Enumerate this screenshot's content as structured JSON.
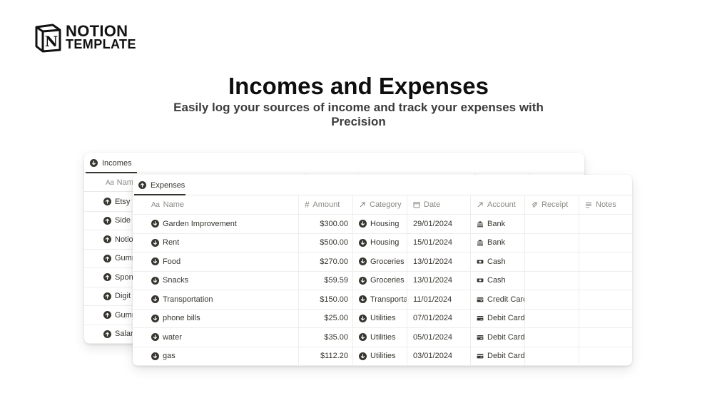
{
  "logo": {
    "line1": "NOTION",
    "line2": "TEMPLATE",
    "mark": "N"
  },
  "hero": {
    "title": "Incomes and Expenses",
    "subtitle": "Easily log your sources of income and track your expenses with Precision"
  },
  "incomes": {
    "tab_label": "Incomes",
    "tab_icon": "arrow-down-circle-icon",
    "name_header": "Nam",
    "rows": [
      {
        "name": "Etsy S"
      },
      {
        "name": "Side I"
      },
      {
        "name": "Notio"
      },
      {
        "name": "Gumr"
      },
      {
        "name": "Spon"
      },
      {
        "name": "Digit"
      },
      {
        "name": "Gumr"
      },
      {
        "name": "Salar"
      }
    ]
  },
  "expenses": {
    "tab_label": "Expenses",
    "tab_icon": "arrow-up-circle-icon",
    "columns": {
      "name": "Name",
      "amount": "Amount",
      "category": "Category",
      "date": "Date",
      "account": "Account",
      "receipt": "Receipt",
      "notes": "Notes"
    },
    "rows": [
      {
        "name": "Garden Improvement",
        "amount": "$300.00",
        "category": "Housing",
        "date": "29/01/2024",
        "account": "Bank",
        "account_icon": "bank-icon"
      },
      {
        "name": "Rent",
        "amount": "$500.00",
        "category": "Housing",
        "date": "15/01/2024",
        "account": "Bank",
        "account_icon": "bank-icon"
      },
      {
        "name": "Food",
        "amount": "$270.00",
        "category": "Groceries",
        "date": "13/01/2024",
        "account": "Cash",
        "account_icon": "cash-icon"
      },
      {
        "name": "Snacks",
        "amount": "$59.59",
        "category": "Groceries",
        "date": "13/01/2024",
        "account": "Cash",
        "account_icon": "cash-icon"
      },
      {
        "name": "Transportation",
        "amount": "$150.00",
        "category": "Transporta",
        "date": "11/01/2024",
        "account": "Credit Carc",
        "account_icon": "credit-card-icon"
      },
      {
        "name": "phone bills",
        "amount": "$25.00",
        "category": "Utilities",
        "date": "07/01/2024",
        "account": "Debit Card",
        "account_icon": "credit-card-icon"
      },
      {
        "name": "water",
        "amount": "$35.00",
        "category": "Utilities",
        "date": "05/01/2024",
        "account": "Debit Card",
        "account_icon": "credit-card-icon"
      },
      {
        "name": "gas",
        "amount": "$112.20",
        "category": "Utilities",
        "date": "03/01/2024",
        "account": "Debit Card",
        "account_icon": "credit-card-icon"
      }
    ]
  },
  "colors": {
    "text": "#37352f",
    "muted": "#8a8a86",
    "border": "#ededeb"
  }
}
